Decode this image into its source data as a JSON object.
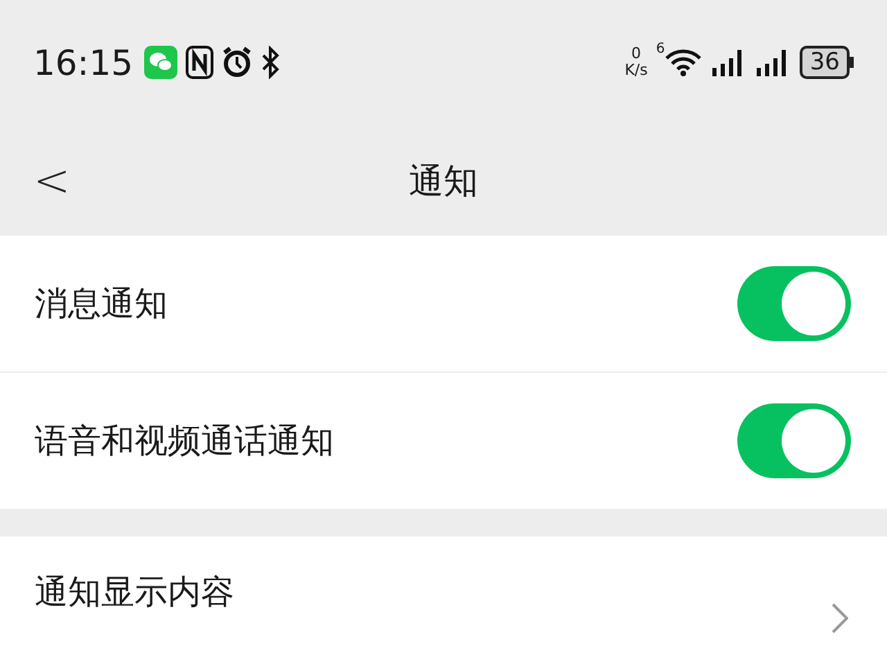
{
  "status_bar": {
    "time": "16:15",
    "speed_value": "0",
    "speed_unit": "K/s",
    "wifi_label": "6",
    "battery": "36"
  },
  "header": {
    "back": "<",
    "title": "通知"
  },
  "sections": [
    {
      "rows": [
        {
          "kind": "toggle",
          "label": "消息通知",
          "on": true
        },
        {
          "kind": "toggle",
          "label": "语音和视频通话通知",
          "on": true
        }
      ]
    },
    {
      "rows": [
        {
          "kind": "link",
          "label": "通知显示内容"
        }
      ]
    }
  ]
}
